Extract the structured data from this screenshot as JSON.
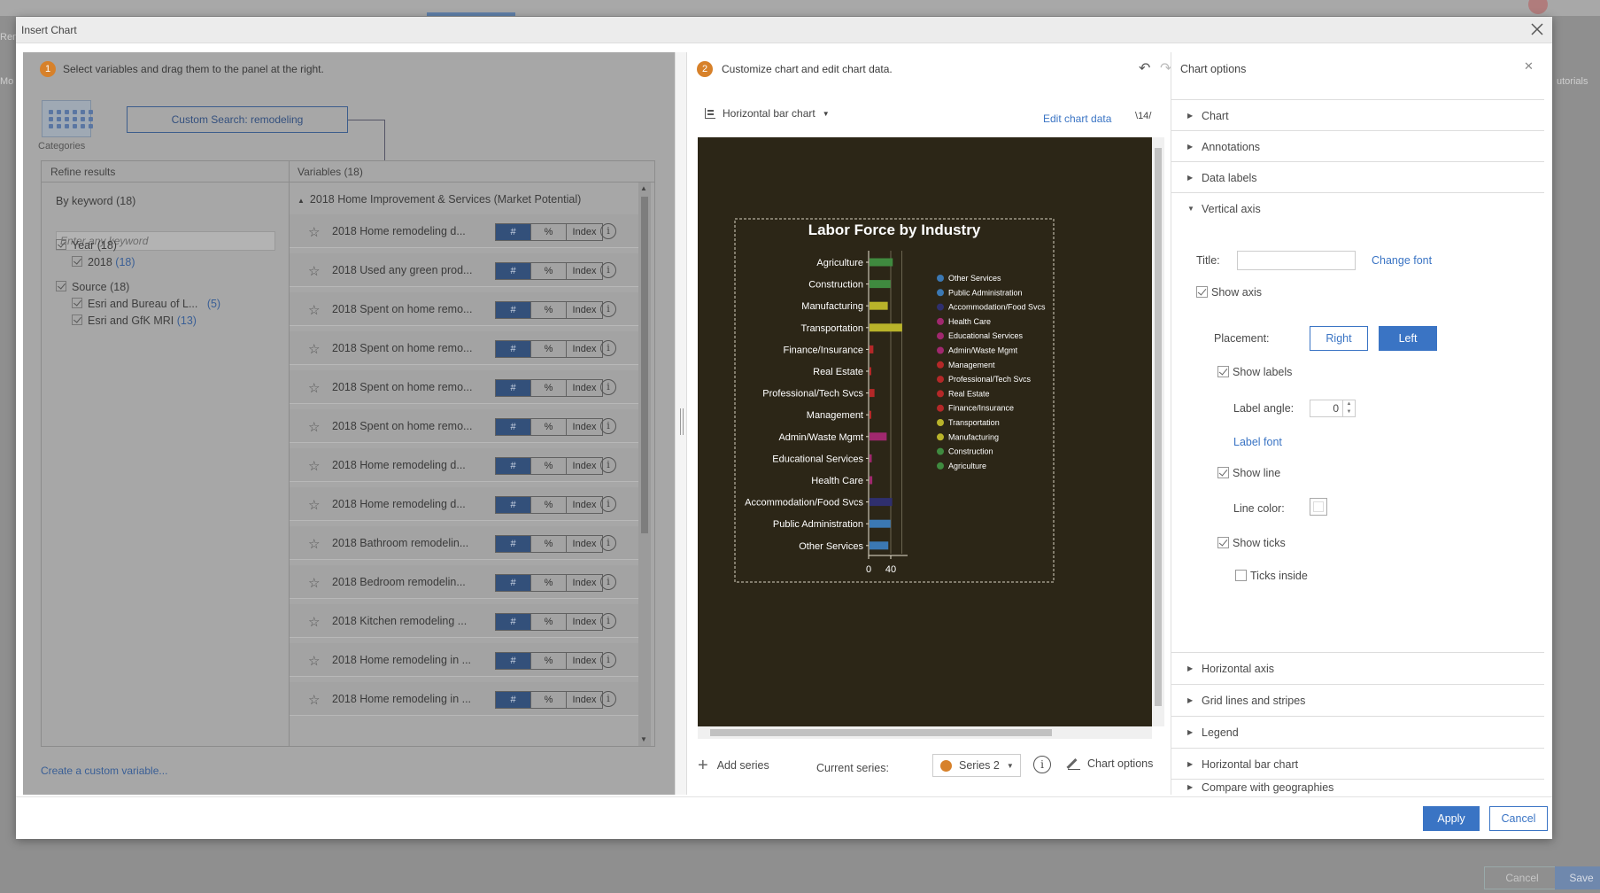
{
  "background": {
    "side_left": "Ren",
    "side_left2": "Mo",
    "side_right": "utorials",
    "cancel": "Cancel",
    "save": "Save"
  },
  "modal": {
    "title": "Insert Chart"
  },
  "left": {
    "step_number": "1",
    "step_text": "Select variables and drag them to the panel at the right.",
    "categories_label": "Categories",
    "custom_search": "Custom Search: remodeling",
    "refine_header": "Refine results",
    "vars_header": "Variables (18)",
    "keyword_label": "By keyword (18)",
    "keyword_placeholder": "Enter any keyword",
    "year_label": "Year (18)",
    "year_item": "2018",
    "year_item_count": "(18)",
    "source_label": "Source (18)",
    "source_item1": "Esri and Bureau of L...",
    "source_item1_count": "(5)",
    "source_item2": "Esri and GfK MRI",
    "source_item2_count": "(13)",
    "group_label": "2018 Home Improvement & Services (Market Potential)",
    "seg_labels": [
      "#",
      "%",
      "Index"
    ],
    "variables": [
      "2018 Home remodeling d...",
      "2018 Used any green prod...",
      "2018 Spent on home remo...",
      "2018 Spent on home remo...",
      "2018 Spent on home remo...",
      "2018 Spent on home remo...",
      "2018 Home remodeling d...",
      "2018 Home remodeling d...",
      "2018 Bathroom remodelin...",
      "2018 Bedroom remodelin...",
      "2018 Kitchen remodeling ...",
      "2018 Home remodeling in ...",
      "2018 Home remodeling in ..."
    ],
    "create_link": "Create a custom variable..."
  },
  "middle": {
    "step_number": "2",
    "step_text": "Customize chart and edit chart data.",
    "chart_type": "Horizontal bar chart",
    "edit_data": "Edit chart data",
    "edit_icon": "14",
    "add_series": "Add series",
    "current_series_label": "Current series:",
    "current_series": "Series 2",
    "chart_options": "Chart options"
  },
  "chart_data": {
    "type": "bar",
    "orientation": "horizontal",
    "title": "Labor Force by Industry",
    "categories": [
      "Agriculture",
      "Construction",
      "Manufacturing",
      "Transportation",
      "Finance/Insurance",
      "Real Estate",
      "Professional/Tech Svcs",
      "Management",
      "Admin/Waste Mgmt",
      "Educational Services",
      "Health Care",
      "Accommodation/Food Svcs",
      "Public Administration",
      "Other Services"
    ],
    "values": [
      42,
      38,
      33,
      59,
      7,
      2,
      9,
      3,
      31,
      4,
      5,
      41,
      38,
      34
    ],
    "colors": [
      "#3f8a3f",
      "#3f8a3f",
      "#b9b32a",
      "#b9b32a",
      "#b42828",
      "#b42828",
      "#b42828",
      "#b42828",
      "#a0286e",
      "#a0286e",
      "#a0286e",
      "#2f2f6e",
      "#3b78b3",
      "#3b78b3"
    ],
    "legend": [
      "Other Services",
      "Public Administration",
      "Accommodation/Food Svcs",
      "Health Care",
      "Educational Services",
      "Admin/Waste Mgmt",
      "Management",
      "Professional/Tech Svcs",
      "Real Estate",
      "Finance/Insurance",
      "Transportation",
      "Manufacturing",
      "Construction",
      "Agriculture"
    ],
    "legend_colors": [
      "#3b78b3",
      "#3b78b3",
      "#2f2f6e",
      "#a0286e",
      "#a0286e",
      "#a0286e",
      "#b42828",
      "#b42828",
      "#b42828",
      "#b42828",
      "#b9b32a",
      "#b9b32a",
      "#3f8a3f",
      "#3f8a3f"
    ],
    "xticks": [
      0,
      40
    ],
    "xlim": [
      0,
      70
    ],
    "background": "#2c2617"
  },
  "right": {
    "title": "Chart options",
    "sections_top": [
      "Chart",
      "Annotations",
      "Data labels"
    ],
    "vertical_axis": "Vertical axis",
    "title_label": "Title:",
    "change_font": "Change font",
    "show_axis": "Show axis",
    "placement_label": "Placement:",
    "placement_right": "Right",
    "placement_left": "Left",
    "show_labels": "Show labels",
    "label_angle_label": "Label angle:",
    "label_angle_value": "0",
    "label_font": "Label font",
    "show_line": "Show line",
    "line_color_label": "Line color:",
    "show_ticks": "Show ticks",
    "ticks_inside": "Ticks inside",
    "sections_bottom": [
      "Horizontal axis",
      "Grid lines and stripes",
      "Legend",
      "Horizontal bar chart",
      "Compare with geographies"
    ]
  },
  "footer": {
    "apply": "Apply",
    "cancel": "Cancel"
  }
}
